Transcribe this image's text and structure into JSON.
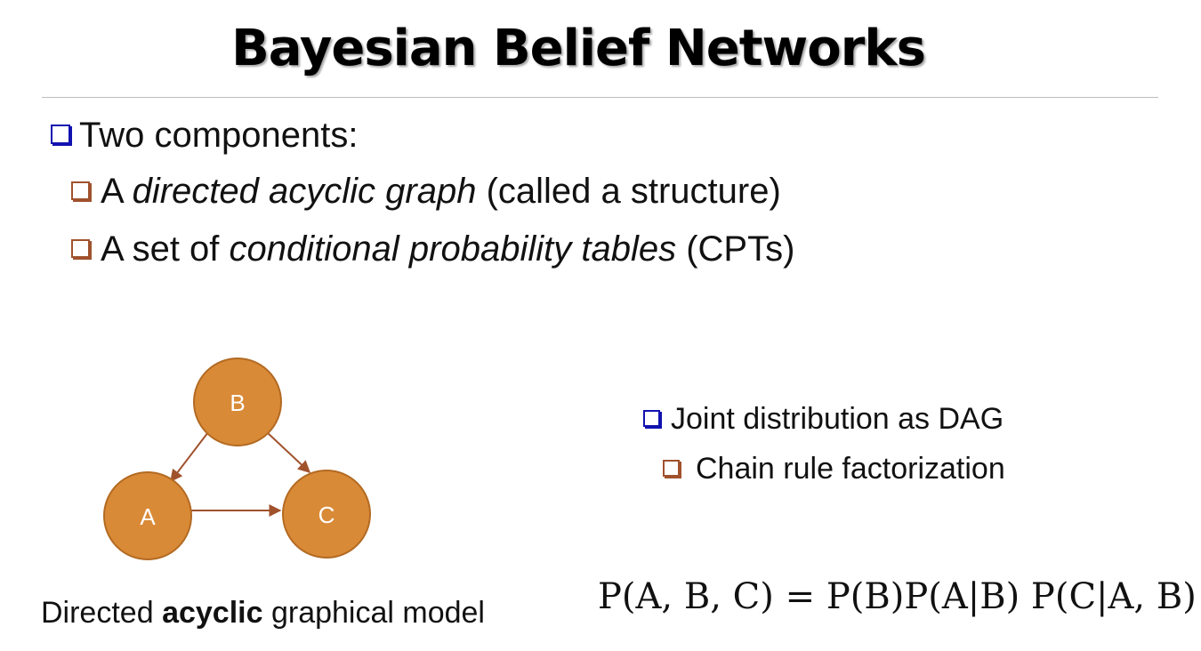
{
  "slide": {
    "title": "Bayesian Belief Networks"
  },
  "bullets": {
    "main": "Two components:",
    "sub": [
      {
        "prefix": "A ",
        "emphasis": "directed acyclic graph",
        "suffix": " (called a structure)"
      },
      {
        "prefix": "A set of ",
        "emphasis": "conditional probability tables",
        "suffix": " (CPTs)"
      }
    ]
  },
  "graph": {
    "nodes": [
      "B",
      "A",
      "C"
    ],
    "edges": [
      [
        "B",
        "A"
      ],
      [
        "B",
        "C"
      ],
      [
        "A",
        "C"
      ]
    ],
    "caption": {
      "before": "Directed ",
      "bold": "acyclic",
      "after": " graphical model"
    }
  },
  "right_panel": {
    "bullet": "Joint distribution as DAG",
    "sub_bullet": "Chain rule factorization",
    "formula": "P(A, B, C) = P(B)P(A|B) P(C|A, B)"
  },
  "colors": {
    "node_fill": "#d98a37",
    "node_stroke": "#b36a22",
    "edge": "#a0522d",
    "bullet_blue": "#1212b0",
    "bullet_brown": "#a0522d"
  }
}
